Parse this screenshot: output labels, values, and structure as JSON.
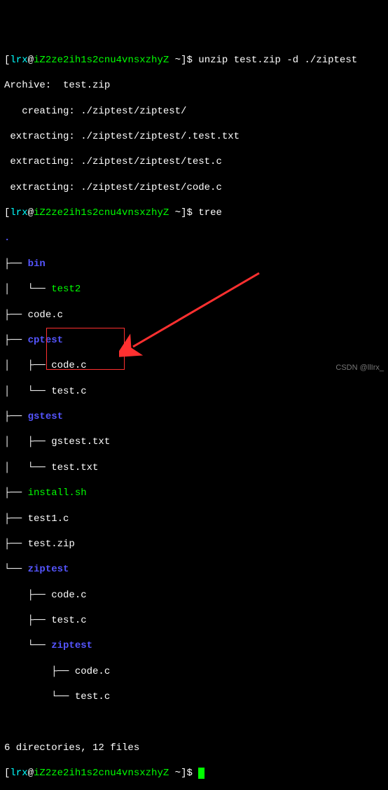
{
  "prompt": {
    "user": "lrx",
    "host": "iZ2ze2ih1s2cnu4vnsxzhyZ",
    "cwd": "~",
    "open": "[",
    "at": "@",
    "close": "]$"
  },
  "cmd1": "unzip test.zip -d ./ziptest",
  "unzip": {
    "archive": "Archive:  test.zip",
    "l1": "   creating: ./ziptest/ziptest/",
    "l2": " extracting: ./ziptest/ziptest/.test.txt",
    "l3": " extracting: ./ziptest/ziptest/test.c",
    "l4": " extracting: ./ziptest/ziptest/code.c"
  },
  "cmd2": "tree",
  "dot": ".",
  "tree": {
    "bin": "├── ",
    "bin_name": "bin",
    "test2": "│   └── ",
    "test2_name": "test2",
    "codec": "├── ",
    "codec_name": "code.c",
    "cptest": "├── ",
    "cptest_name": "cptest",
    "cp_codec": "│   ├── ",
    "cp_codec_name": "code.c",
    "cp_testc": "│   └── ",
    "cp_testc_name": "test.c",
    "gstest": "├── ",
    "gstest_name": "gstest",
    "gs_txt": "│   ├── ",
    "gs_txt_name": "gstest.txt",
    "gs_test": "│   └── ",
    "gs_test_name": "test.txt",
    "install": "├── ",
    "install_name": "install.sh",
    "test1": "├── ",
    "test1_name": "test1.c",
    "testzip": "├── ",
    "testzip_name": "test.zip",
    "ziptest": "└── ",
    "ziptest_name": "ziptest",
    "zt_codec": "    ├── ",
    "zt_codec_name": "code.c",
    "zt_testc": "    ├── ",
    "zt_testc_name": "test.c",
    "zt_sub": "    └── ",
    "zt_sub_name": "ziptest",
    "zt2_codec": "        ├── ",
    "zt2_codec_name": "code.c",
    "zt2_testc": "        └── ",
    "zt2_testc_name": "test.c"
  },
  "summary": "6 directories, 12 files",
  "watermark": "CSDN @llIrx_"
}
